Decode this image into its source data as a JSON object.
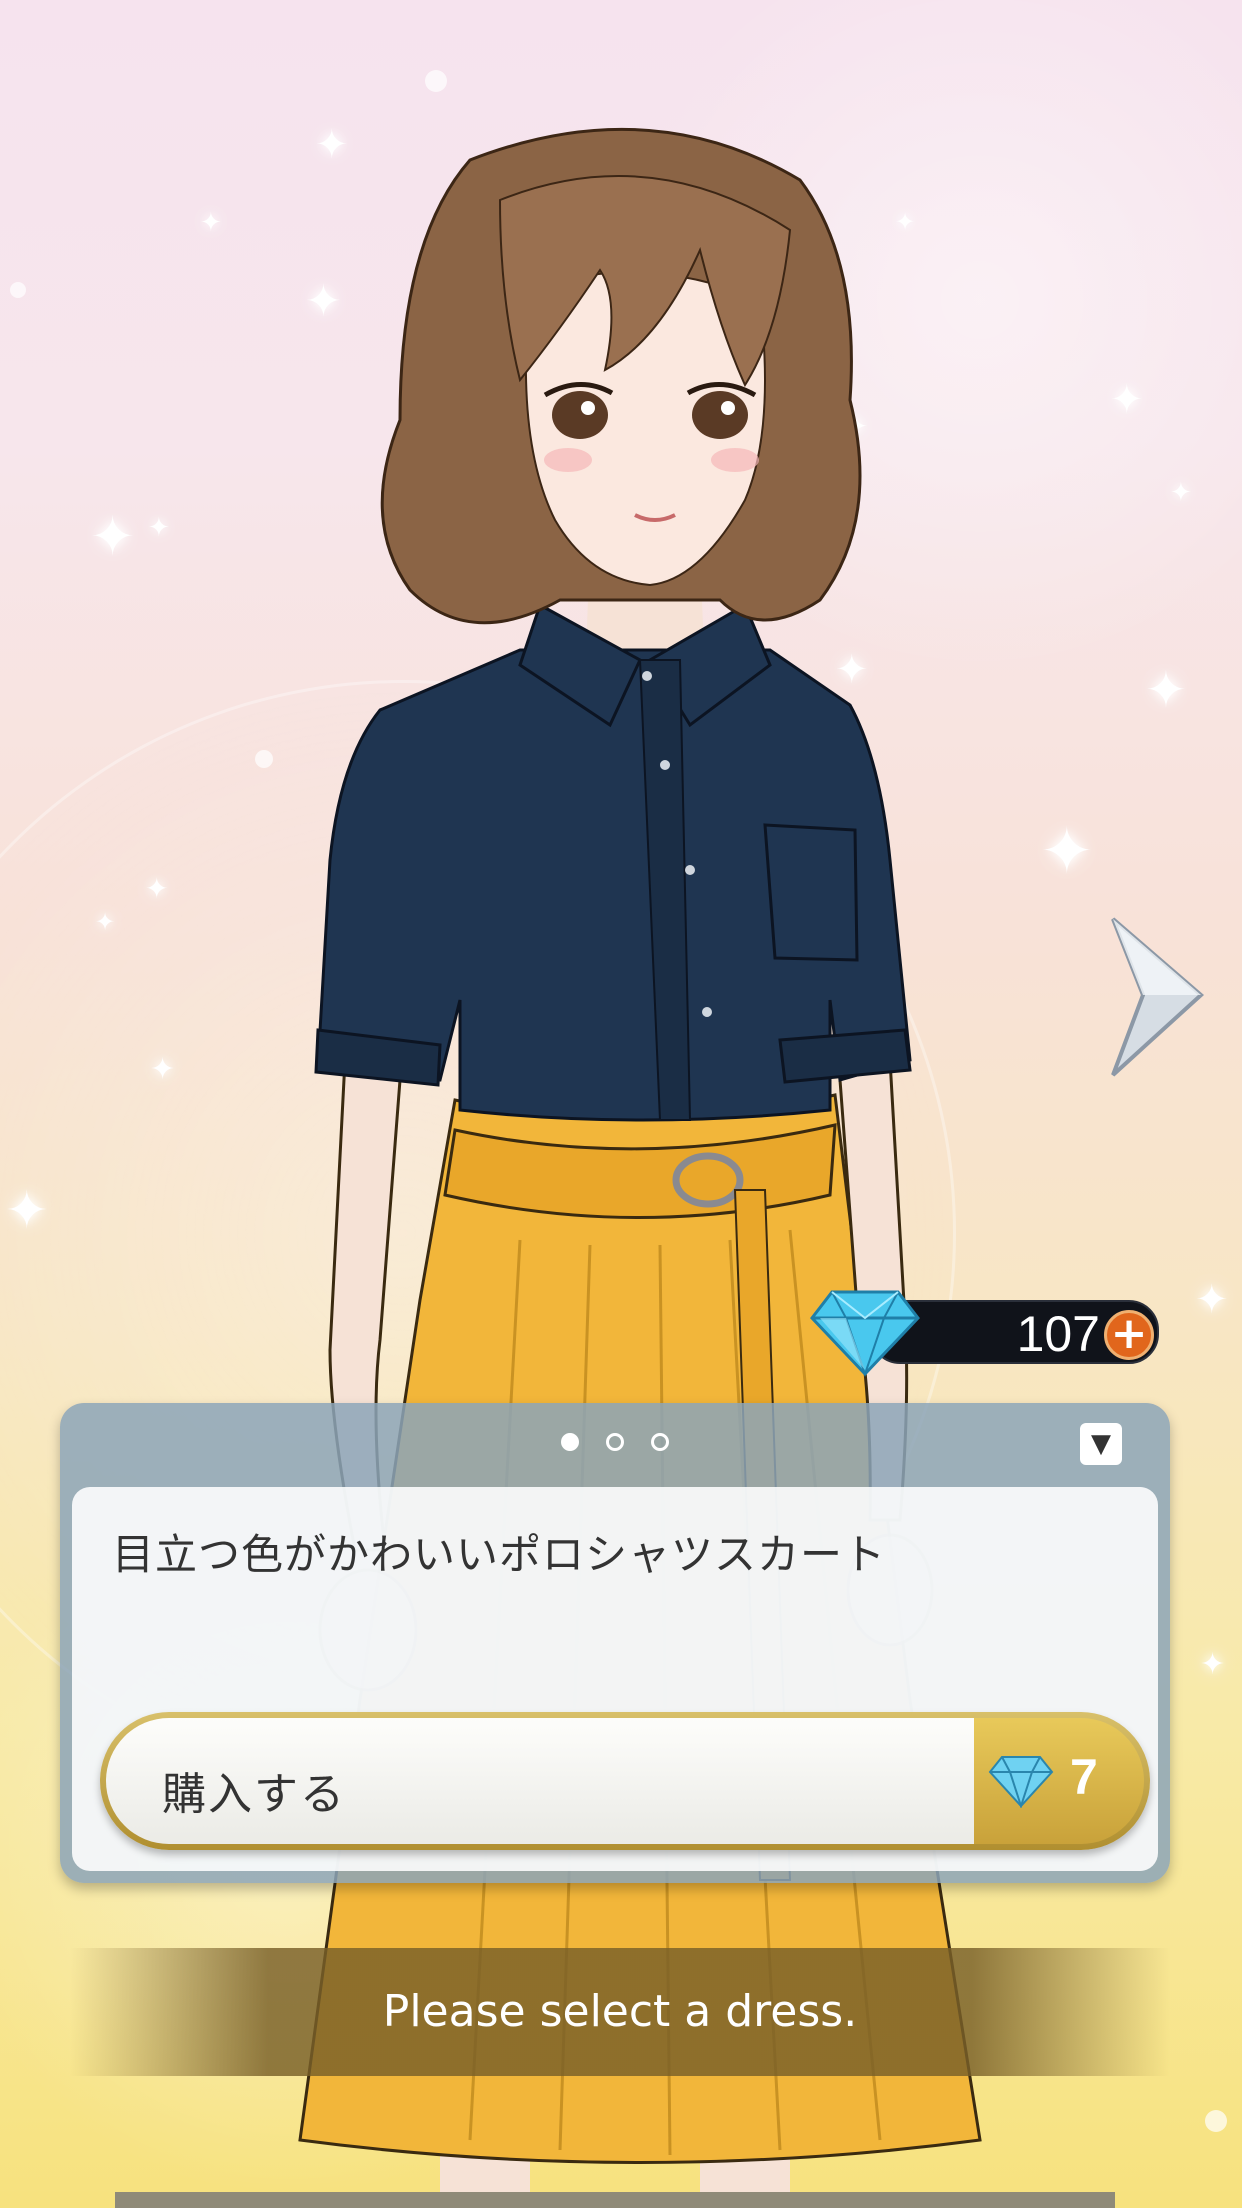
{
  "character": {
    "name": ""
  },
  "currency": {
    "gem_count": "107",
    "add_label": "+"
  },
  "pager": {
    "page_count": 3,
    "active_index": 0
  },
  "panel": {
    "collapse_icon": "▼",
    "item_description": "目立つ色がかわいいポロシャツスカート",
    "buy_label": "購入する",
    "price": "7"
  },
  "message": "Please select a dress.",
  "colors": {
    "shirt": "#1f3551",
    "skirt": "#f2b63a",
    "hair": "#8b6445",
    "accent_orange": "#e1661c",
    "gem_blue": "#49c8ee"
  }
}
